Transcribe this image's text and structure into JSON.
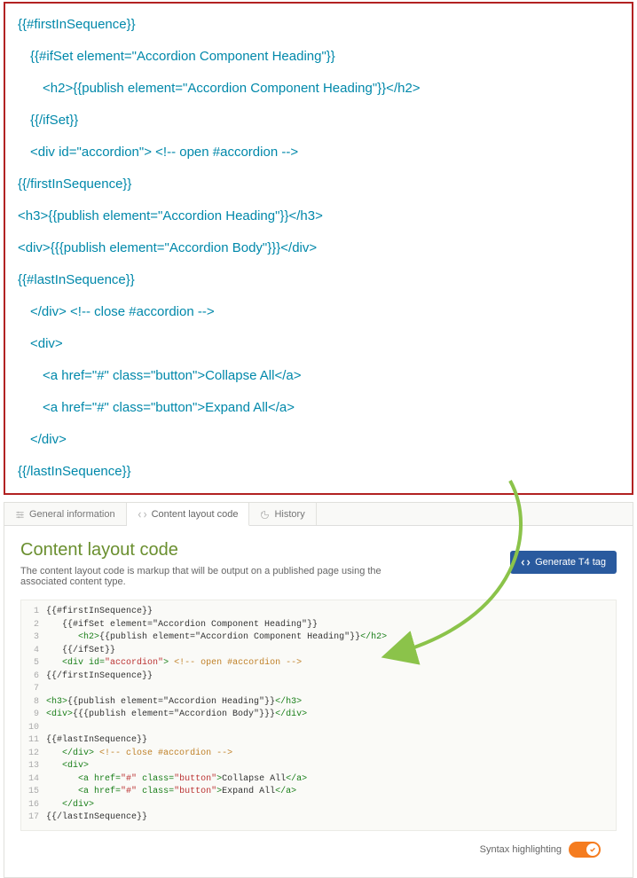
{
  "top_code": {
    "l1": "{{#firstInSequence}}",
    "l2": "{{#ifSet element=\"Accordion Component Heading\"}}",
    "l3": "<h2>{{publish element=\"Accordion Component Heading\"}}</h2>",
    "l4": "{{/ifSet}}",
    "l5": "<div id=\"accordion\"> <!-- open #accordion -->",
    "l6": "{{/firstInSequence}}",
    "l7": "<h3>{{publish element=\"Accordion Heading\"}}</h3>",
    "l8": "<div>{{{publish element=\"Accordion Body\"}}}</div>",
    "l9": "{{#lastInSequence}}",
    "l10": "</div> <!-- close #accordion -->",
    "l11": "<div>",
    "l12": "<a href=\"#\" class=\"button\">Collapse All</a>",
    "l13": "<a href=\"#\" class=\"button\">Expand All</a>",
    "l14": "</div>",
    "l15": "{{/lastInSequence}}"
  },
  "tabs": {
    "general": "General information",
    "content": "Content layout code",
    "history": "History"
  },
  "panel": {
    "title": "Content layout code",
    "desc": "The content layout code is markup that will be output on a published page using the associated content type.",
    "button": "Generate T4 tag"
  },
  "editor": {
    "l1": {
      "n": "1",
      "ind": 0,
      "seg": [
        {
          "c": "c-txt",
          "t": "{{#firstInSequence}}"
        }
      ]
    },
    "l2": {
      "n": "2",
      "ind": 1,
      "seg": [
        {
          "c": "c-txt",
          "t": "{{#ifSet element=\"Accordion Component Heading\"}}"
        }
      ]
    },
    "l3": {
      "n": "3",
      "ind": 2,
      "seg": [
        {
          "c": "c-tag",
          "t": "<h2>"
        },
        {
          "c": "c-txt",
          "t": "{{publish element=\"Accordion Component Heading\"}}"
        },
        {
          "c": "c-tag",
          "t": "</h2>"
        }
      ]
    },
    "l4": {
      "n": "4",
      "ind": 1,
      "seg": [
        {
          "c": "c-txt",
          "t": "{{/ifSet}}"
        }
      ]
    },
    "l5": {
      "n": "5",
      "ind": 1,
      "seg": [
        {
          "c": "c-tag",
          "t": "<div "
        },
        {
          "c": "c-attr",
          "t": "id="
        },
        {
          "c": "c-str",
          "t": "\"accordion\""
        },
        {
          "c": "c-tag",
          "t": ">"
        },
        {
          "c": "c-txt",
          "t": " "
        },
        {
          "c": "c-com",
          "t": "<!-- open #accordion -->"
        }
      ]
    },
    "l6": {
      "n": "6",
      "ind": 0,
      "seg": [
        {
          "c": "c-txt",
          "t": "{{/firstInSequence}}"
        }
      ]
    },
    "l7": {
      "n": "7",
      "ind": 0,
      "seg": []
    },
    "l8": {
      "n": "8",
      "ind": 0,
      "seg": [
        {
          "c": "c-tag",
          "t": "<h3>"
        },
        {
          "c": "c-txt",
          "t": "{{publish element=\"Accordion Heading\"}}"
        },
        {
          "c": "c-tag",
          "t": "</h3>"
        }
      ]
    },
    "l9": {
      "n": "9",
      "ind": 0,
      "seg": [
        {
          "c": "c-tag",
          "t": "<div>"
        },
        {
          "c": "c-txt",
          "t": "{{{publish element=\"Accordion Body\"}}}"
        },
        {
          "c": "c-tag",
          "t": "</div>"
        }
      ]
    },
    "l10": {
      "n": "10",
      "ind": 0,
      "seg": []
    },
    "l11": {
      "n": "11",
      "ind": 0,
      "seg": [
        {
          "c": "c-txt",
          "t": "{{#lastInSequence}}"
        }
      ]
    },
    "l12": {
      "n": "12",
      "ind": 1,
      "seg": [
        {
          "c": "c-tag",
          "t": "</div>"
        },
        {
          "c": "c-txt",
          "t": " "
        },
        {
          "c": "c-com",
          "t": "<!-- close #accordion -->"
        }
      ]
    },
    "l13": {
      "n": "13",
      "ind": 1,
      "seg": [
        {
          "c": "c-tag",
          "t": "<div>"
        }
      ]
    },
    "l14": {
      "n": "14",
      "ind": 2,
      "seg": [
        {
          "c": "c-tag",
          "t": "<a "
        },
        {
          "c": "c-attr",
          "t": "href="
        },
        {
          "c": "c-str",
          "t": "\"#\""
        },
        {
          "c": "c-tag",
          "t": " "
        },
        {
          "c": "c-attr",
          "t": "class="
        },
        {
          "c": "c-str",
          "t": "\"button\""
        },
        {
          "c": "c-tag",
          "t": ">"
        },
        {
          "c": "c-txt",
          "t": "Collapse All"
        },
        {
          "c": "c-tag",
          "t": "</a>"
        }
      ]
    },
    "l15": {
      "n": "15",
      "ind": 2,
      "seg": [
        {
          "c": "c-tag",
          "t": "<a "
        },
        {
          "c": "c-attr",
          "t": "href="
        },
        {
          "c": "c-str",
          "t": "\"#\""
        },
        {
          "c": "c-tag",
          "t": " "
        },
        {
          "c": "c-attr",
          "t": "class="
        },
        {
          "c": "c-str",
          "t": "\"button\""
        },
        {
          "c": "c-tag",
          "t": ">"
        },
        {
          "c": "c-txt",
          "t": "Expand All"
        },
        {
          "c": "c-tag",
          "t": "</a>"
        }
      ]
    },
    "l16": {
      "n": "16",
      "ind": 1,
      "seg": [
        {
          "c": "c-tag",
          "t": "</div>"
        }
      ]
    },
    "l17": {
      "n": "17",
      "ind": 0,
      "seg": [
        {
          "c": "c-txt",
          "t": "{{/lastInSequence}}"
        }
      ]
    }
  },
  "syntax": {
    "label": "Syntax highlighting"
  }
}
